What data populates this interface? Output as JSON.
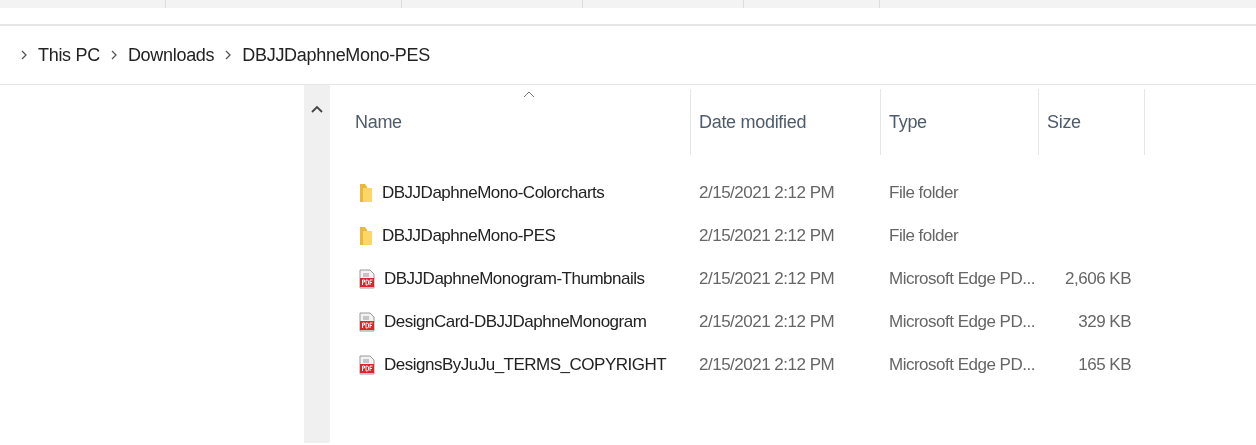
{
  "breadcrumb": [
    {
      "label": "This PC"
    },
    {
      "label": "Downloads"
    },
    {
      "label": "DBJJDaphneMono-PES"
    }
  ],
  "columns": [
    {
      "label": "Name",
      "sorted": true
    },
    {
      "label": "Date modified",
      "sorted": false
    },
    {
      "label": "Type",
      "sorted": false
    },
    {
      "label": "Size",
      "sorted": false
    }
  ],
  "rows": [
    {
      "kind": "folder",
      "name": "DBJJDaphneMono-Colorcharts",
      "date": "2/15/2021 2:12 PM",
      "type": "File folder"
    },
    {
      "kind": "folder",
      "name": "DBJJDaphneMono-PES",
      "date": "2/15/2021 2:12 PM",
      "type": "File folder"
    },
    {
      "kind": "pdf",
      "name": "DBJJDaphneMonogram-Thumbnails",
      "date": "2/15/2021 2:12 PM",
      "type": "Microsoft Edge PD...",
      "size": "2,606 KB"
    },
    {
      "kind": "pdf",
      "name": "DesignCard-DBJJDaphneMonogram",
      "date": "2/15/2021 2:12 PM",
      "type": "Microsoft Edge PD...",
      "size": "329 KB"
    },
    {
      "kind": "pdf",
      "name": "DesignsByJuJu_TERMS_COPYRIGHT",
      "date": "2/15/2021 2:12 PM",
      "type": "Microsoft Edge PD...",
      "size": "165 KB"
    }
  ]
}
